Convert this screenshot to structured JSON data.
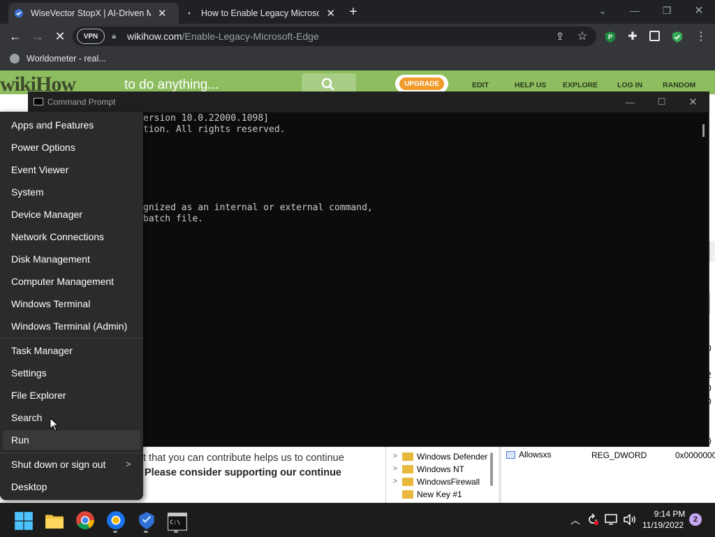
{
  "browser": {
    "tabs": [
      {
        "title": "WiseVector StopX | AI-Driven Ma",
        "active": true
      },
      {
        "title": "How to Enable Legacy Microsoft",
        "active": false
      }
    ],
    "new_tab": "+",
    "vpn_label": "VPN",
    "url_host": "wikihow.com",
    "url_path": "/Enable-Legacy-Microsoft-Edge",
    "bookmark": "Worldometer - real..."
  },
  "website": {
    "logo": "wikiHow",
    "tagline": "to do anything...",
    "upgrade": "UPGRADE",
    "nav": [
      "EDIT",
      "HELP US",
      "EXPLORE",
      "LOG IN",
      "RANDOM"
    ],
    "text_line1": "t that you can contribute helps us to continue",
    "text_line2": "Please consider supporting our continue"
  },
  "regedit": {
    "tree_items": [
      "Windows Defender",
      "Windows NT",
      "WindowsFirewall",
      "New Key #1"
    ],
    "value_name": "Allowsxs",
    "value_type": "REG_DWORD",
    "value_data": "0x0000000",
    "edge_chars": [
      "t",
      "0",
      "",
      "2",
      "0",
      "0",
      "",
      "0"
    ]
  },
  "cmd": {
    "title": "Command Prompt",
    "lines": [
      "ersion 10.0.22000.1098]",
      "tion. All rights reserved.",
      "",
      "gnized as an internal or external command,",
      "batch file."
    ]
  },
  "menu": {
    "group1": [
      "Apps and Features",
      "Power Options",
      "Event Viewer",
      "System",
      "Device Manager",
      "Network Connections",
      "Disk Management",
      "Computer Management",
      "Windows Terminal",
      "Windows Terminal (Admin)"
    ],
    "group2": [
      "Task Manager",
      "Settings",
      "File Explorer",
      "Search",
      "Run"
    ],
    "group3": [
      "Shut down or sign out",
      "Desktop"
    ]
  },
  "taskbar": {
    "time": "9:14 PM",
    "date": "11/19/2022",
    "notifications": "2"
  }
}
